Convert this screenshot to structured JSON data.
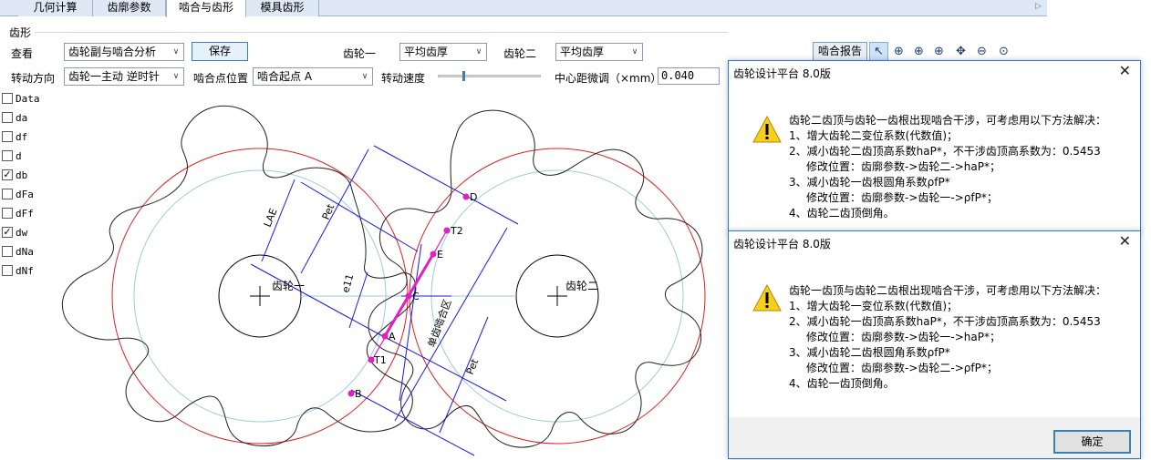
{
  "tabs": [
    {
      "label": "几何计算",
      "active": false
    },
    {
      "label": "齿廓参数",
      "active": false
    },
    {
      "label": "啮合与齿形",
      "active": true
    },
    {
      "label": "模具齿形",
      "active": false
    }
  ],
  "group_title": "齿形",
  "row1": {
    "view_label": "查看",
    "view_value": "齿轮副与啮合分析",
    "save_button": "保存",
    "gear1_label": "齿轮一",
    "gear1_value": "平均齿厚",
    "gear2_label": "齿轮二",
    "gear2_value": "平均齿厚",
    "report_button": "啮合报告"
  },
  "row2": {
    "direction_label": "转动方向",
    "direction_value": "齿轮一主动 逆时针",
    "point_label": "啮合点位置",
    "point_value": "啮合起点 A",
    "speed_label": "转动速度",
    "center_label": "中心距微调（×mm）",
    "center_value": "0.040"
  },
  "checklist": [
    {
      "label": "Data",
      "checked": false
    },
    {
      "label": "da",
      "checked": false
    },
    {
      "label": "df",
      "checked": false
    },
    {
      "label": "d",
      "checked": false
    },
    {
      "label": "db",
      "checked": true
    },
    {
      "label": "dFa",
      "checked": false
    },
    {
      "label": "dFf",
      "checked": false
    },
    {
      "label": "dw",
      "checked": true
    },
    {
      "label": "dNa",
      "checked": false
    },
    {
      "label": "dNf",
      "checked": false
    }
  ],
  "diagram": {
    "gear1_label": "齿轮一",
    "gear2_label": "齿轮二",
    "points": [
      "D",
      "T2",
      "E",
      "C",
      "A",
      "T1",
      "B"
    ],
    "dim_labels": [
      "LAE",
      "Pet",
      "e11",
      "单齿啮合区",
      "Pet"
    ]
  },
  "dialog1": {
    "title": "齿轮设计平台 8.0版",
    "lines": [
      "齿轮二齿顶与齿轮一齿根出现啮合干涉，可考虑用以下方法解决：",
      "1、增大齿轮二变位系数(代数值)；",
      "2、减小齿轮二齿顶高系数haP*，不干涉齿顶高系数为：0.5453",
      "修改位置：齿廓参数->齿轮二->haP*；",
      "3、减小齿轮一齿根圆角系数ρfP*",
      "修改位置：齿廓参数->齿轮一->ρfP*；",
      "4、齿轮二齿顶倒角。"
    ]
  },
  "dialog2": {
    "title": "齿轮设计平台 8.0版",
    "lines": [
      "齿轮一齿顶与齿轮二齿根出现啮合干涉，可考虑用以下方法解决：",
      "1、增大齿轮一变位系数(代数值)；",
      "2、减小齿轮一齿顶高系数haP*，不干涉齿顶高系数为：0.5453",
      "修改位置：齿廓参数->齿轮一->haP*；",
      "3、减小齿轮二齿根圆角系数ρfP*",
      "修改位置：齿廓参数->齿轮二->ρfP*；",
      "4、齿轮一齿顶倒角。"
    ],
    "ok_button": "确定"
  },
  "colors": {
    "base_circle": "#e02020",
    "pitch_circle": "#9ccbe0",
    "dimension": "#1a1ae6",
    "action_line": "#e020c0"
  }
}
